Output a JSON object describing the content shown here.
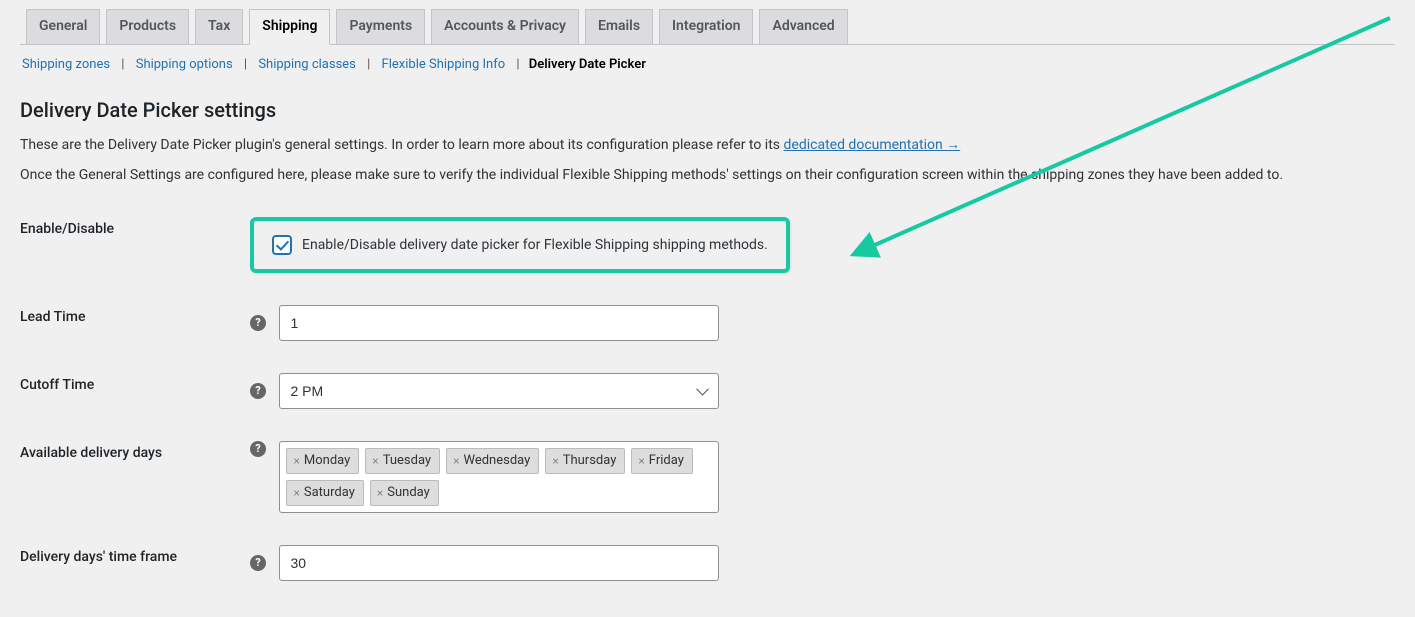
{
  "tabs": {
    "general": "General",
    "products": "Products",
    "tax": "Tax",
    "shipping": "Shipping",
    "payments": "Payments",
    "accounts": "Accounts & Privacy",
    "emails": "Emails",
    "integration": "Integration",
    "advanced": "Advanced"
  },
  "subtabs": {
    "zones": "Shipping zones",
    "options": "Shipping options",
    "classes": "Shipping classes",
    "fs_info": "Flexible Shipping Info",
    "current": "Delivery Date Picker"
  },
  "page": {
    "title": "Delivery Date Picker settings",
    "intro_prefix": "These are the Delivery Date Picker plugin's general settings. In order to learn more about its configuration please refer to its ",
    "intro_link": "dedicated documentation →",
    "intro2": "Once the General Settings are configured here, please make sure to verify the individual Flexible Shipping methods' settings on their configuration screen within the shipping zones they have been added to."
  },
  "fields": {
    "enable": {
      "label": "Enable/Disable",
      "cb_label": "Enable/Disable delivery date picker for Flexible Shipping shipping methods.",
      "checked": true
    },
    "lead_time": {
      "label": "Lead Time",
      "value": "1"
    },
    "cutoff": {
      "label": "Cutoff Time",
      "value": "2 PM"
    },
    "days": {
      "label": "Available delivery days",
      "values": [
        "Monday",
        "Tuesday",
        "Wednesday",
        "Thursday",
        "Friday",
        "Saturday",
        "Sunday"
      ]
    },
    "frame": {
      "label": "Delivery days' time frame",
      "value": "30"
    }
  }
}
